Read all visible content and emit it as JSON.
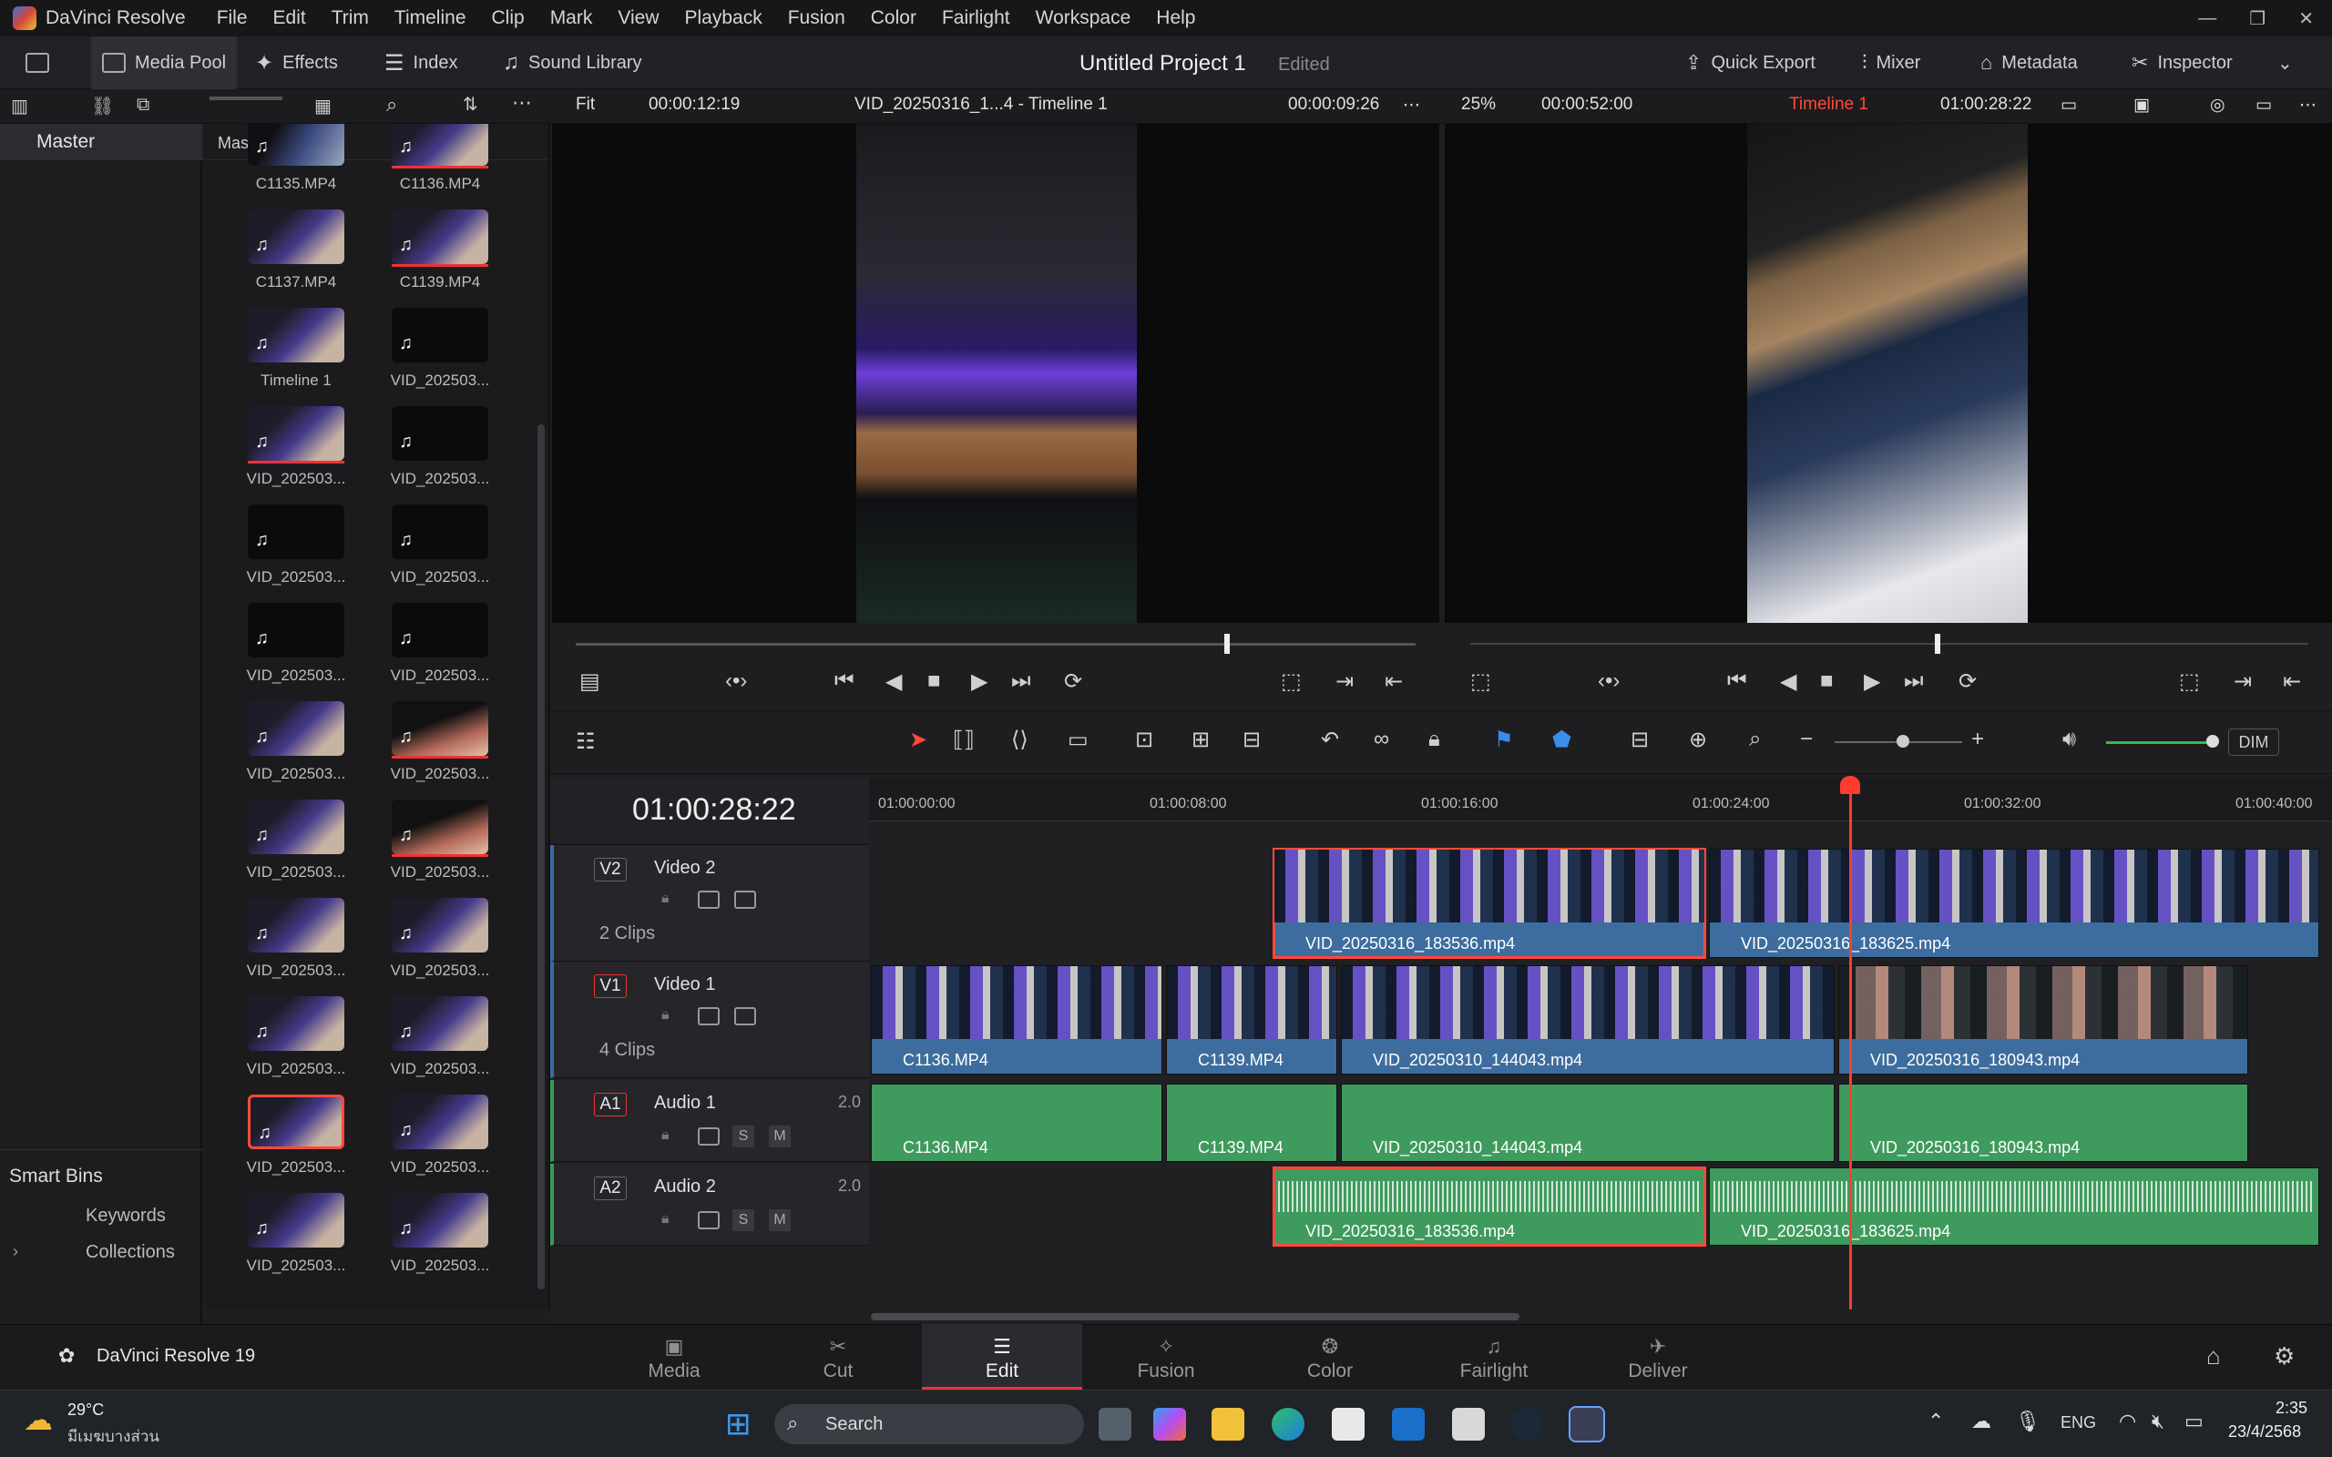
{
  "menubar": {
    "app": "DaVinci Resolve",
    "items": [
      "File",
      "Edit",
      "Trim",
      "Timeline",
      "Clip",
      "Mark",
      "View",
      "Playback",
      "Fusion",
      "Color",
      "Fairlight",
      "Workspace",
      "Help"
    ]
  },
  "toolbar": {
    "media_pool": "Media Pool",
    "effects": "Effects",
    "index": "Index",
    "sound_library": "Sound Library",
    "project_title": "Untitled Project 1",
    "project_status": "Edited",
    "quick_export": "Quick Export",
    "mixer": "Mixer",
    "metadata": "Metadata",
    "inspector": "Inspector"
  },
  "source_viewer": {
    "zoom": "Fit",
    "timecode_left": "00:00:12:19",
    "clip_name": "VID_20250316_1...4 - Timeline 1",
    "timecode_right": "00:00:09:26"
  },
  "timeline_viewer": {
    "zoom": "25%",
    "duration": "00:00:52:00",
    "timeline_name": "Timeline 1",
    "timecode": "01:00:28:22"
  },
  "sidebar": {
    "master": "Master",
    "smart_bins": "Smart Bins",
    "keywords": "Keywords",
    "collections": "Collections"
  },
  "pool": {
    "header": "Master",
    "clips": [
      {
        "label": "C1135.MP4"
      },
      {
        "label": "C1136.MP4"
      },
      {
        "label": "C1137.MP4"
      },
      {
        "label": "C1139.MP4"
      },
      {
        "label": "Timeline 1"
      },
      {
        "label": "VID_202503..."
      },
      {
        "label": "VID_202503..."
      },
      {
        "label": "VID_202503..."
      },
      {
        "label": "VID_202503..."
      },
      {
        "label": "VID_202503..."
      },
      {
        "label": "VID_202503..."
      },
      {
        "label": "VID_202503..."
      },
      {
        "label": "VID_202503..."
      },
      {
        "label": "VID_202503..."
      },
      {
        "label": "VID_202503..."
      },
      {
        "label": "VID_202503..."
      },
      {
        "label": "VID_202503..."
      },
      {
        "label": "VID_202503..."
      },
      {
        "label": "VID_202503..."
      },
      {
        "label": "VID_202503..."
      },
      {
        "label": "VID_202503..."
      },
      {
        "label": "VID_202503..."
      },
      {
        "label": "VID_202503..."
      },
      {
        "label": "VID_202503..."
      }
    ]
  },
  "timeline": {
    "timecode": "01:00:28:22",
    "ruler": [
      "01:00:00:00",
      "01:00:08:00",
      "01:00:16:00",
      "01:00:24:00",
      "01:00:32:00",
      "01:00:40:00"
    ],
    "tracks": {
      "v2": {
        "id": "V2",
        "name": "Video 2",
        "count": "2 Clips"
      },
      "v1": {
        "id": "V1",
        "name": "Video 1",
        "count": "4 Clips"
      },
      "a1": {
        "id": "A1",
        "name": "Audio 1",
        "channels": "2.0"
      },
      "a2": {
        "id": "A2",
        "name": "Audio 2",
        "channels": "2.0"
      }
    },
    "clips": {
      "v2a": "VID_20250316_183536.mp4",
      "v2b": "VID_20250316_183625.mp4",
      "v1a": "C1136.MP4",
      "v1b": "C1139.MP4",
      "v1c": "VID_20250310_144043.mp4",
      "v1d": "VID_20250316_180943.mp4",
      "a1a": "C1136.MP4",
      "a1b": "C1139.MP4",
      "a1c": "VID_20250310_144043.mp4",
      "a1d": "VID_20250316_180943.mp4",
      "a2a": "VID_20250316_183536.mp4",
      "a2b": "VID_20250316_183625.mp4"
    },
    "dim": "DIM",
    "solo": "S",
    "mute": "M"
  },
  "pages": {
    "brand": "DaVinci Resolve 19",
    "tabs": [
      "Media",
      "Cut",
      "Edit",
      "Fusion",
      "Color",
      "Fairlight",
      "Deliver"
    ],
    "active": "Edit"
  },
  "taskbar": {
    "temp": "29°C",
    "weather": "มีเมฆบางส่วน",
    "search": "Search",
    "lang": "ENG",
    "time": "2:35",
    "date": "23/4/2568"
  }
}
